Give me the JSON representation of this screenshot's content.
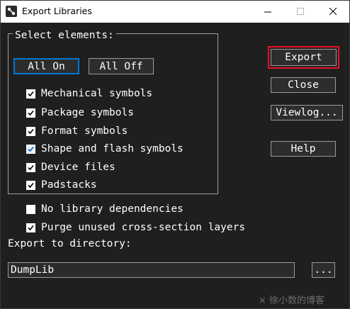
{
  "window": {
    "title": "Export Libraries"
  },
  "group": {
    "label": "Select elements:"
  },
  "buttons": {
    "all_on": "All On",
    "all_off": "All Off",
    "export": "Export",
    "close": "Close",
    "viewlog": "Viewlog...",
    "help": "Help",
    "browse": "..."
  },
  "elements": [
    {
      "label": "Mechanical symbols",
      "checked": true
    },
    {
      "label": "Package symbols",
      "checked": true
    },
    {
      "label": "Format symbols",
      "checked": true
    },
    {
      "label": "Shape and flash symbols",
      "checked": true
    },
    {
      "label": "Device files",
      "checked": true
    },
    {
      "label": "Padstacks",
      "checked": true
    }
  ],
  "options": [
    {
      "label": "No library dependencies",
      "checked": false
    },
    {
      "label": "Purge unused cross-section layers",
      "checked": true
    }
  ],
  "export_dir": {
    "label": "Export to directory:",
    "value": "DumpLib"
  },
  "watermark": "× 徐小数的博客",
  "colors": {
    "background": "#1f1f1f",
    "highlight": "#e81123",
    "focus": "#0078d4"
  }
}
